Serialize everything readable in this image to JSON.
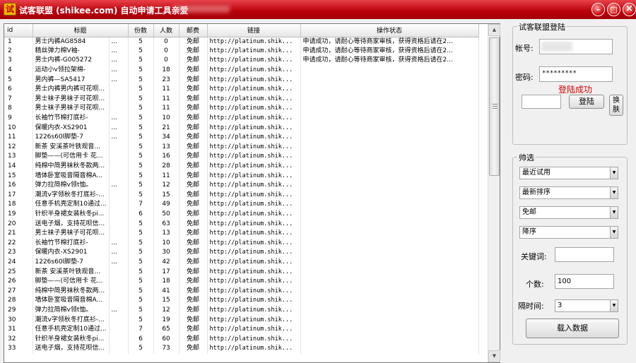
{
  "window": {
    "icon_char": "试",
    "title": "试客联盟 (shikee.com) 自动申请工具亲爱",
    "min_label": "–",
    "max_label": "□",
    "close_label": "×"
  },
  "table": {
    "headers": [
      "id",
      "标题",
      "份数",
      "人数",
      "邮费",
      "链接",
      "操作状态"
    ],
    "rows": [
      [
        "1",
        "男士内裤AG8584",
        "...",
        "5",
        "0",
        "免邮",
        "http://platinum.shik...",
        "申请成功，请耐心等待商家审核，获得资格后请在2..."
      ],
      [
        "2",
        "精丝弹力棉V袖-",
        "...",
        "5",
        "0",
        "免邮",
        "http://platinum.shik...",
        "申请成功，请耐心等待商家审核，获得资格后请在2..."
      ],
      [
        "3",
        "男士内裤-G005272",
        "...",
        "5",
        "0",
        "免邮",
        "http://platinum.shik...",
        "申请成功，请耐心等待商家审核，获得资格后请在2..."
      ],
      [
        "4",
        "运动小v领拉架棉-",
        "...",
        "5",
        "18",
        "免邮",
        "http://platinum.shik...",
        ""
      ],
      [
        "5",
        "男内裤—SA5417",
        "...",
        "5",
        "23",
        "免邮",
        "http://platinum.shik...",
        ""
      ],
      [
        "6",
        "男士内裤男内裤可花呗...",
        "",
        "5",
        "11",
        "免邮",
        "http://platinum.shik...",
        ""
      ],
      [
        "7",
        "男士袜子男袜子可花呗...",
        "",
        "5",
        "11",
        "免邮",
        "http://platinum.shik...",
        ""
      ],
      [
        "8",
        "男士袜子男袜子可花呗...",
        "",
        "5",
        "11",
        "免邮",
        "http://platinum.shik...",
        ""
      ],
      [
        "9",
        "长袖竹节棉打底衫-",
        "...",
        "5",
        "10",
        "免邮",
        "http://platinum.shik...",
        ""
      ],
      [
        "10",
        "保暖内衣-XS2901",
        "...",
        "5",
        "21",
        "免邮",
        "http://platinum.shik...",
        ""
      ],
      [
        "11",
        "1226s60l脚垫-7",
        "...",
        "5",
        "34",
        "免邮",
        "http://platinum.shik...",
        ""
      ],
      [
        "12",
        "新茶 安溪茶叶铁观音...",
        "",
        "5",
        "13",
        "免邮",
        "http://platinum.shik...",
        ""
      ],
      [
        "13",
        "脚垫——(可信用卡 花...",
        "",
        "5",
        "16",
        "免邮",
        "http://platinum.shik...",
        ""
      ],
      [
        "14",
        "纯棉中简男袜秋冬款两...",
        "",
        "5",
        "28",
        "免邮",
        "http://platinum.shik...",
        ""
      ],
      [
        "15",
        "墙体卧室吸音隔音棉A...",
        "",
        "5",
        "11",
        "免邮",
        "http://platinum.shik...",
        ""
      ],
      [
        "16",
        "弹力拉简棉v领t恤。",
        "...",
        "5",
        "12",
        "免邮",
        "http://platinum.shik...",
        ""
      ],
      [
        "17",
        "潮流v字领秋冬打底衫-...",
        "",
        "5",
        "15",
        "免邮",
        "http://platinum.shik...",
        ""
      ],
      [
        "18",
        "任意手机壳定制10通过...",
        "",
        "7",
        "49",
        "免邮",
        "http://platinum.shik...",
        ""
      ],
      [
        "19",
        "针织半身裙女装秋冬pi...",
        "",
        "6",
        "50",
        "免邮",
        "http://platinum.shik...",
        ""
      ],
      [
        "20",
        "送电子烟，支持花呗信...",
        "",
        "5",
        "63",
        "免邮",
        "http://platinum.shik...",
        ""
      ],
      [
        "21",
        "男士袜子男袜子可花呗...",
        "",
        "5",
        "13",
        "免邮",
        "http://platinum.shik...",
        ""
      ],
      [
        "22",
        "长袖竹节棉打底衫-",
        "...",
        "5",
        "10",
        "免邮",
        "http://platinum.shik...",
        ""
      ],
      [
        "23",
        "保暖内衣-XS2901",
        "...",
        "5",
        "30",
        "免邮",
        "http://platinum.shik...",
        ""
      ],
      [
        "24",
        "1226s60l脚垫-7",
        "...",
        "5",
        "42",
        "免邮",
        "http://platinum.shik...",
        ""
      ],
      [
        "25",
        "新茶 安溪茶叶铁观音...",
        "",
        "5",
        "17",
        "免邮",
        "http://platinum.shik...",
        ""
      ],
      [
        "26",
        "脚垫——(可信用卡 花...",
        "",
        "5",
        "18",
        "免邮",
        "http://platinum.shik...",
        ""
      ],
      [
        "27",
        "纯棉中简男袜秋冬款两...",
        "",
        "5",
        "41",
        "免邮",
        "http://platinum.shik...",
        ""
      ],
      [
        "28",
        "墙体卧室吸音隔音棉A...",
        "",
        "5",
        "15",
        "免邮",
        "http://platinum.shik...",
        ""
      ],
      [
        "29",
        "弹力拉简棉v领t恤。",
        "...",
        "5",
        "12",
        "免邮",
        "http://platinum.shik...",
        ""
      ],
      [
        "30",
        "潮流v字领秋冬打底衫-...",
        "",
        "5",
        "19",
        "免邮",
        "http://platinum.shik...",
        ""
      ],
      [
        "31",
        "任意手机壳定制10通过...",
        "",
        "7",
        "65",
        "免邮",
        "http://platinum.shik...",
        ""
      ],
      [
        "32",
        "针织半身裙女装秋冬pi...",
        "",
        "6",
        "60",
        "免邮",
        "http://platinum.shik...",
        ""
      ],
      [
        "33",
        "送电子烟，支持花呗信...",
        "",
        "5",
        "73",
        "免邮",
        "http://platinum.shik...",
        ""
      ]
    ]
  },
  "scrollbar": {
    "up": "▲",
    "down": "▼"
  },
  "login": {
    "group_title": "试客联盟登陆",
    "account_label": "帐号:",
    "account_value": "",
    "password_label": "密码:",
    "password_value": "*********",
    "status": "登陆成功",
    "captcha_value": "",
    "login_button": "登陆",
    "switch_button": "换肤",
    "status_color": "#d40000"
  },
  "filter": {
    "group_title": "帅选",
    "sort_by": "最近试用",
    "order_by": "最新排序",
    "shipping": "免邮",
    "direction": "降序",
    "keyword_label": "关键词:",
    "keyword_value": "",
    "count_label": "个数:",
    "count_value": "100",
    "interval_label": "隔时间:",
    "interval_value": "3",
    "load_button": "载入数据"
  }
}
